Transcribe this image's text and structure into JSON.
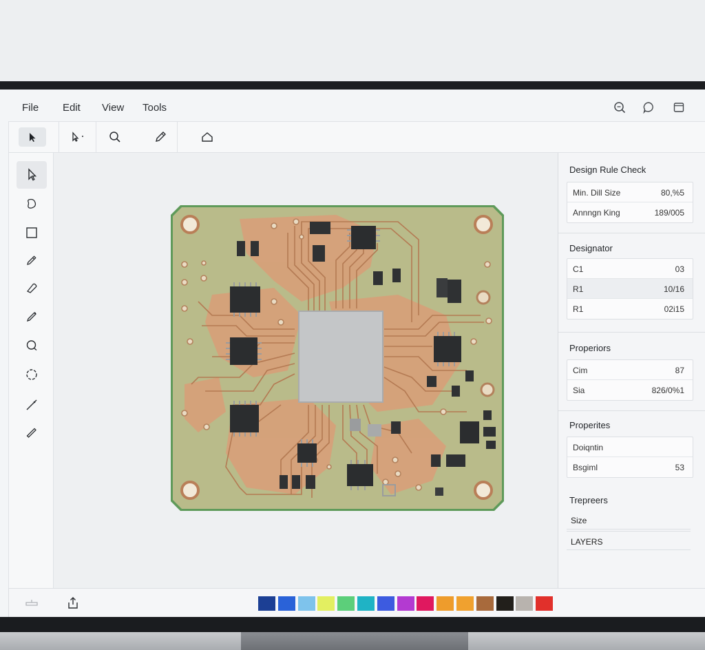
{
  "menu": {
    "file": "File",
    "edit": "Edit",
    "view": "View",
    "tools": "Tools"
  },
  "top_right_icons": [
    "zoom-search-icon",
    "comment-icon",
    "window-icon"
  ],
  "toolbar": {
    "icons": [
      "select-arrow-icon",
      "pointer-dropdown-icon",
      "magnifier-icon",
      "pencil-icon",
      "home-icon"
    ]
  },
  "left_tools": [
    "cursor-icon",
    "shape-icon",
    "rectangle-icon",
    "pen-icon",
    "eraser-icon",
    "brush-icon",
    "lasso-icon",
    "circle-select-icon",
    "line-icon",
    "ruler-icon"
  ],
  "right_panel": {
    "drc": {
      "title": "Design Rule Check",
      "rows": [
        {
          "key": "Min. Dill Size",
          "value": "80,%5"
        },
        {
          "key": "Annngn King",
          "value": "189/005"
        }
      ]
    },
    "designator": {
      "title": "Designator",
      "rows": [
        {
          "key": "C1",
          "value": "03"
        },
        {
          "key": "R1",
          "value": "10/16"
        },
        {
          "key": "R1",
          "value": "02i15"
        }
      ]
    },
    "properiors": {
      "title": "Properiors",
      "rows": [
        {
          "key": "Cim",
          "value": "87"
        },
        {
          "key": "Sia",
          "value": "826/0%1"
        }
      ]
    },
    "properites": {
      "title": "Properites",
      "rows": [
        {
          "key": "Doiqntin",
          "value": ""
        },
        {
          "key": "Bsgiml",
          "value": "53"
        }
      ]
    },
    "trepreers": {
      "title": "Trepreers",
      "size_label": "Size",
      "layers_label": "LAYERS"
    }
  },
  "status_icons": [
    "layers-icon",
    "share-icon"
  ],
  "palette": [
    "#1c3f94",
    "#2a62d8",
    "#7ec3ec",
    "#e3ef61",
    "#5ccf7a",
    "#1fb3c5",
    "#3d5be0",
    "#b33ad1",
    "#e0185f",
    "#ee9c2c",
    "#f0a12f",
    "#a86a3c",
    "#221f1b",
    "#b8b3ae",
    "#e1302b"
  ],
  "colors": {
    "board": "#b9bb8a",
    "board_edge": "#5f9a5a",
    "copper": "#d99e78",
    "trace": "#c58a62",
    "chip": "#2b2d2f",
    "center_chip": "#c4c6c8"
  }
}
